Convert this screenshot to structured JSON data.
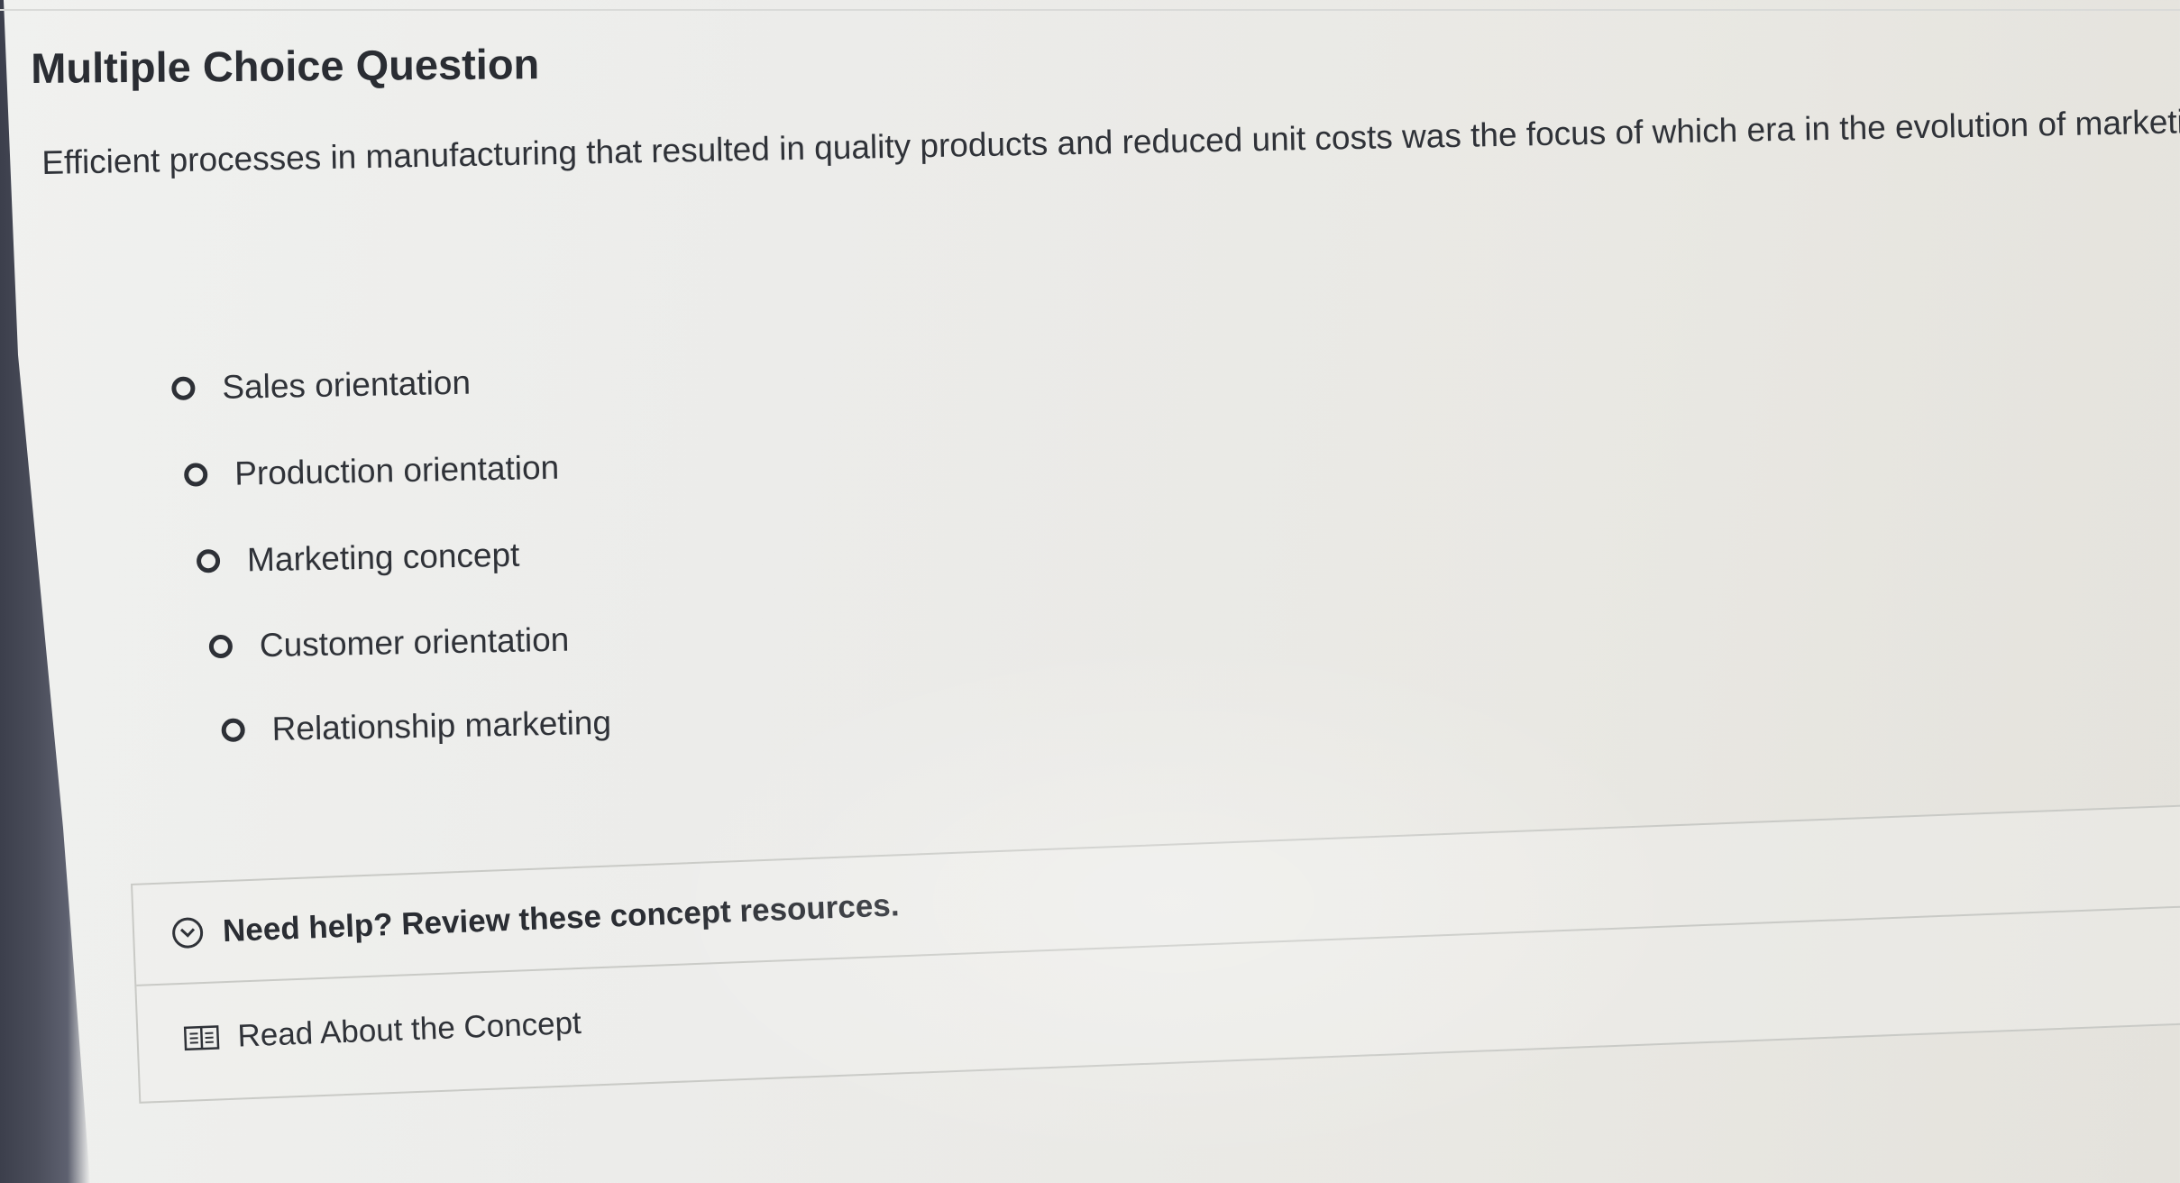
{
  "question": {
    "heading": "Multiple Choice Question",
    "prompt": "Efficient processes in manufacturing that resulted in quality products and reduced unit costs was the focus of which era in the evolution of marketi"
  },
  "options": [
    {
      "label": "Sales orientation",
      "selected": false
    },
    {
      "label": "Production orientation",
      "selected": false
    },
    {
      "label": "Marketing concept",
      "selected": false
    },
    {
      "label": "Customer orientation",
      "selected": false
    },
    {
      "label": "Relationship marketing",
      "selected": false
    }
  ],
  "help": {
    "title": "Need help? Review these concept resources.",
    "resource_label": "Read About the Concept"
  },
  "icons": {
    "radio": "radio-unselected-icon",
    "expand": "chevron-down-circle-icon",
    "resource": "book-icon"
  }
}
